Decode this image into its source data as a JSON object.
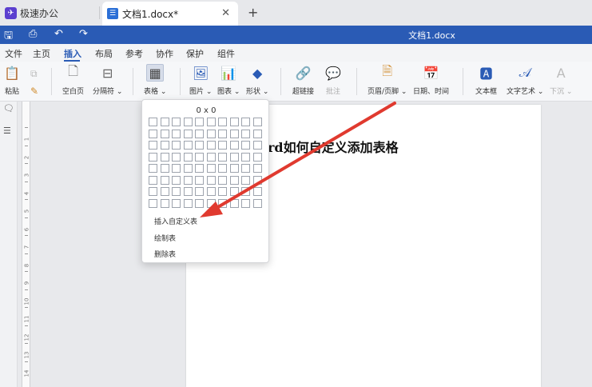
{
  "app": {
    "name": "极速办公"
  },
  "document_tab": {
    "title": "文档1.docx*",
    "close_icon": "close-icon",
    "new_tab_icon": "plus-icon"
  },
  "quickbar": {
    "title": "文档1.docx"
  },
  "menu": {
    "items": [
      "文件",
      "主页",
      "插入",
      "布局",
      "参考",
      "协作",
      "保护",
      "组件"
    ],
    "active": "插入"
  },
  "ribbon": {
    "paste": "粘贴",
    "blank_page": "空白页",
    "page_break": "分隔符",
    "table": "表格",
    "image": "图片",
    "chart": "图表",
    "shape": "形状",
    "hyperlink": "超链接",
    "comment": "批注",
    "header_footer": "页眉/页脚",
    "date_time": "日期、时间",
    "text_box": "文本框",
    "word_art": "文字艺术",
    "drop_cap": "下沉"
  },
  "document": {
    "heading": "rd如何自定义添加表格"
  },
  "table_dropdown": {
    "grid_size": "0 x 0",
    "rows": 8,
    "cols": 10,
    "items": [
      "插入自定义表",
      "绘制表",
      "删除表"
    ]
  },
  "ruler": {
    "numbers": [
      "1",
      "2",
      "3",
      "4",
      "5",
      "6",
      "7",
      "8",
      "9",
      "10",
      "11",
      "12",
      "13",
      "14"
    ]
  },
  "colors": {
    "accent": "#2a5bb5",
    "annotation_arrow": "#e03a2f"
  }
}
